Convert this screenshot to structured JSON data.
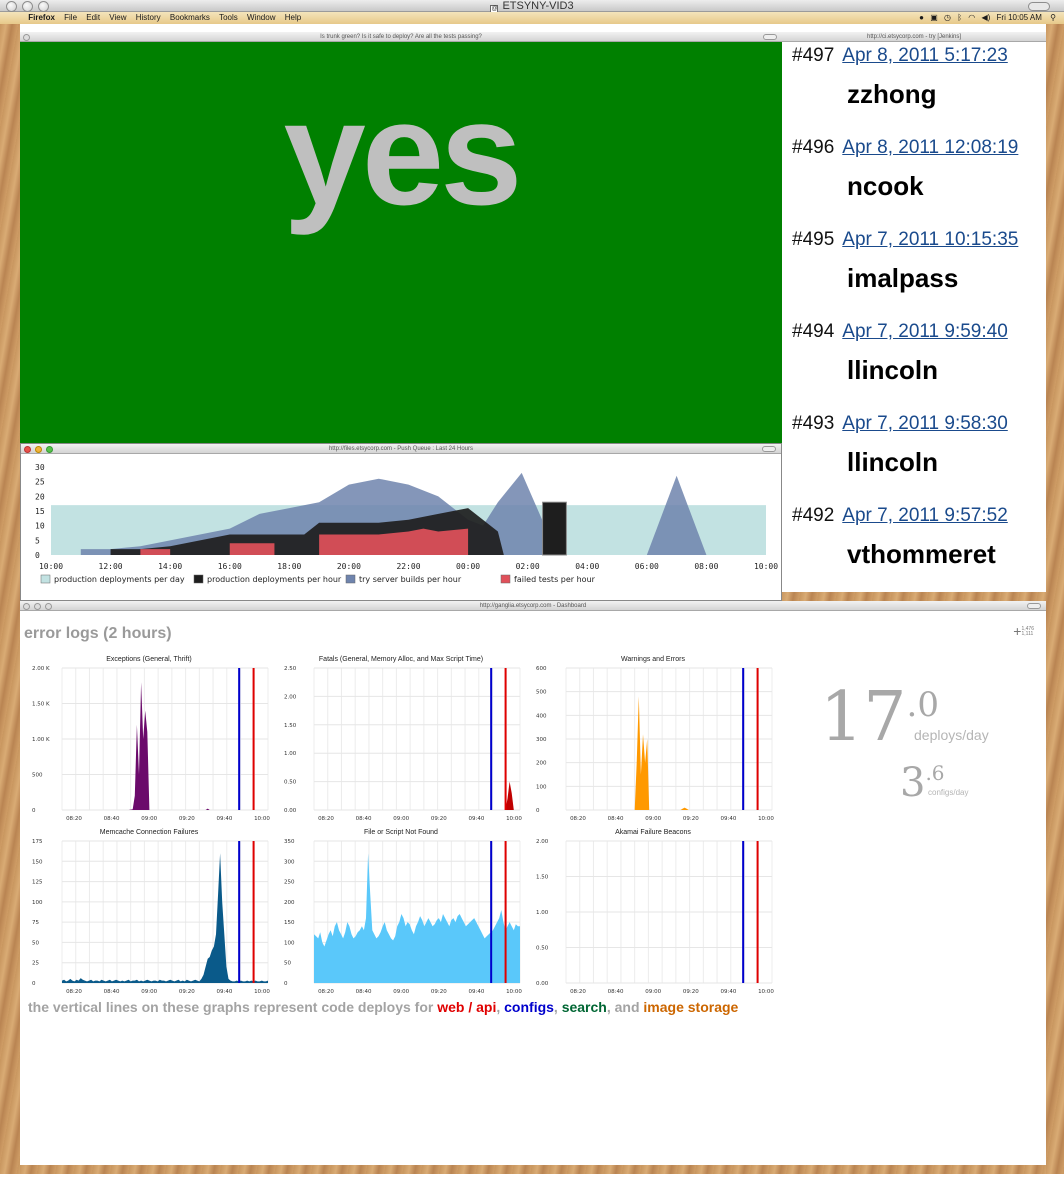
{
  "os": {
    "window_title": "ETSYNY-VID3",
    "menu": {
      "app": "Firefox",
      "items": [
        "File",
        "Edit",
        "View",
        "History",
        "Bookmarks",
        "Tools",
        "Window",
        "Help"
      ],
      "clock": "Fri 10:05 AM"
    }
  },
  "trunk": {
    "title": "Is trunk green? Is it safe to deploy? Are all the tests passing?",
    "answer": "yes",
    "bg_color": "#008000"
  },
  "jenkins": {
    "title": "http://ci.etsycorp.com - try [Jenkins]",
    "builds": [
      {
        "number": "#497",
        "date": "Apr 8, 2011 5:17:23",
        "user": "zzhong"
      },
      {
        "number": "#496",
        "date": "Apr 8, 2011 12:08:19",
        "user": "ncook"
      },
      {
        "number": "#495",
        "date": "Apr 7, 2011 10:15:35",
        "user": "imalpass"
      },
      {
        "number": "#494",
        "date": "Apr 7, 2011 9:59:40",
        "user": "llincoln"
      },
      {
        "number": "#493",
        "date": "Apr 7, 2011 9:58:30",
        "user": "llincoln"
      },
      {
        "number": "#492",
        "date": "Apr 7, 2011 9:57:52",
        "user": "vthommeret"
      }
    ]
  },
  "push_queue": {
    "title": "http://files.etsycorp.com - Push Queue : Last 24 Hours",
    "chart_data": {
      "type": "area",
      "x_ticks": [
        "10:00",
        "12:00",
        "14:00",
        "16:00",
        "18:00",
        "20:00",
        "22:00",
        "00:00",
        "02:00",
        "04:00",
        "06:00",
        "08:00",
        "10:00"
      ],
      "y_ticks": [
        0,
        5,
        10,
        15,
        20,
        25,
        30
      ],
      "ylim": [
        0,
        30
      ],
      "xlim": [
        0,
        24
      ],
      "series": [
        {
          "name": "production deployments per day",
          "color": "#c2e2e2",
          "kind": "band",
          "value": 17
        },
        {
          "name": "try server builds per hour",
          "color": "#6f84ad",
          "kind": "area",
          "points": [
            [
              1,
              0
            ],
            [
              1,
              2
            ],
            [
              2,
              2
            ],
            [
              3,
              3
            ],
            [
              4,
              5
            ],
            [
              5,
              7
            ],
            [
              6,
              9
            ],
            [
              7,
              14
            ],
            [
              8,
              16
            ],
            [
              9,
              18
            ],
            [
              10,
              24
            ],
            [
              11,
              26
            ],
            [
              12,
              24
            ],
            [
              13,
              20
            ],
            [
              14,
              12
            ],
            [
              14.5,
              10
            ],
            [
              15,
              18
            ],
            [
              15.8,
              28
            ],
            [
              17,
              0
            ]
          ]
        },
        {
          "name": "try server builds per hour peak",
          "color": "#6f84ad",
          "kind": "triangle",
          "points": [
            [
              20,
              0
            ],
            [
              21,
              27
            ],
            [
              22,
              0
            ]
          ]
        },
        {
          "name": "production deployments per hour",
          "color": "#1e1e1e",
          "kind": "area",
          "points": [
            [
              2,
              0
            ],
            [
              2,
              2
            ],
            [
              3,
              2
            ],
            [
              4,
              3
            ],
            [
              5,
              5
            ],
            [
              6,
              7
            ],
            [
              6.5,
              7
            ],
            [
              8.5,
              7
            ],
            [
              9,
              11
            ],
            [
              11,
              11
            ],
            [
              12,
              12
            ],
            [
              13,
              14
            ],
            [
              14,
              16
            ],
            [
              15,
              8
            ],
            [
              15.2,
              0
            ]
          ]
        },
        {
          "name": "production deployments per hour spike",
          "color": "#1e1e1e",
          "kind": "bar",
          "x0": 16.5,
          "x1": 17.3,
          "value": 18
        },
        {
          "name": "failed tests per hour",
          "color": "#e0505a",
          "kind": "area",
          "points": [
            [
              3,
              0
            ],
            [
              3,
              2
            ],
            [
              4,
              2
            ],
            [
              4,
              0
            ],
            [
              6,
              0
            ],
            [
              6,
              4
            ],
            [
              7,
              4
            ],
            [
              7.5,
              4
            ],
            [
              7.5,
              0
            ],
            [
              9,
              0
            ],
            [
              9,
              7
            ],
            [
              11,
              7
            ],
            [
              12,
              8
            ],
            [
              12.5,
              9
            ],
            [
              13,
              8
            ],
            [
              14,
              9
            ],
            [
              14,
              0
            ]
          ]
        }
      ],
      "legend": [
        {
          "label": "production deployments per day",
          "color": "#c2e2e2"
        },
        {
          "label": "production deployments per hour",
          "color": "#1e1e1e"
        },
        {
          "label": "try server builds per hour",
          "color": "#6f84ad"
        },
        {
          "label": "failed tests per hour",
          "color": "#e0505a"
        }
      ]
    }
  },
  "dashboard": {
    "title": "http://ganglia.etsycorp.com - Dashboard",
    "heading": "error logs (2 hours)",
    "cursor_readout": [
      "1,476",
      "1,111"
    ],
    "deploy_colors": {
      "web_api": "#e00000",
      "configs": "#0000cc"
    },
    "graphs_chart_data": [
      {
        "type": "area",
        "title": "Exceptions (General, Thrift)",
        "color": "#6b0a6b",
        "y_ticks": [
          "2.00 K",
          "1.50 K",
          "1.00 K",
          "500",
          "0"
        ],
        "ymax": 2000,
        "x_ticks": [
          "08:20",
          "08:40",
          "09:00",
          "09:20",
          "09:40",
          "10:00"
        ],
        "deploys": {
          "configs": 0.86,
          "web_api": 0.93
        },
        "values": [
          0,
          0,
          0,
          0,
          0,
          0,
          0,
          0,
          0,
          0,
          0,
          0,
          0,
          0,
          0,
          0,
          0,
          0,
          0,
          0,
          0,
          0,
          0,
          0,
          0,
          0,
          0,
          0,
          0,
          0,
          0,
          0,
          0,
          5,
          10,
          200,
          1200,
          500,
          1800,
          1000,
          1400,
          1100,
          0,
          0,
          0,
          0,
          0,
          0,
          0,
          0,
          0,
          0,
          0,
          0,
          0,
          0,
          0,
          0,
          0,
          0,
          0,
          0,
          0,
          0,
          0,
          0,
          0,
          0,
          0,
          0,
          20,
          0,
          0,
          0,
          0,
          0,
          0,
          0,
          0,
          0,
          0,
          0,
          0,
          0,
          0,
          0,
          0,
          0,
          0,
          0,
          0,
          0,
          0,
          0,
          0,
          0,
          0,
          0,
          0,
          0
        ]
      },
      {
        "type": "area",
        "title": "Fatals (General, Memory Alloc, and Max Script Time)",
        "color": "#c00000",
        "y_ticks": [
          "2.50",
          "2.00",
          "1.50",
          "1.00",
          "0.50",
          "0.00"
        ],
        "ymax": 2.5,
        "x_ticks": [
          "08:20",
          "08:40",
          "09:00",
          "09:20",
          "09:40",
          "10:00"
        ],
        "deploys": {
          "configs": 0.86,
          "web_api": 0.93
        },
        "values": [
          0,
          0,
          0,
          0,
          0,
          0,
          0,
          0,
          0,
          0,
          0,
          0,
          0,
          0,
          0,
          0,
          0,
          0,
          0,
          0,
          0,
          0,
          0,
          0,
          0,
          0,
          0,
          0,
          0,
          0,
          0,
          0,
          0,
          0,
          0,
          0,
          0,
          0,
          0,
          0,
          0,
          0,
          0,
          0,
          0,
          0,
          0,
          0,
          0,
          0,
          0,
          0,
          0,
          0,
          0,
          0,
          0,
          0,
          0,
          0,
          0,
          0,
          0,
          0,
          0,
          0,
          0,
          0,
          0,
          0,
          0,
          0,
          0,
          0,
          0,
          0,
          0,
          0,
          0,
          0,
          0,
          0,
          0,
          0,
          0,
          0,
          0,
          0,
          0,
          0,
          0,
          0,
          0,
          0.2,
          0.5,
          0.3,
          0,
          0,
          0,
          0
        ]
      },
      {
        "type": "area",
        "title": "Warnings and Errors",
        "color": "#ff9900",
        "y_ticks": [
          "600",
          "500",
          "400",
          "300",
          "200",
          "100",
          "0"
        ],
        "ymax": 600,
        "x_ticks": [
          "08:20",
          "08:40",
          "09:00",
          "09:20",
          "09:40",
          "10:00"
        ],
        "deploys": {
          "configs": 0.86,
          "web_api": 0.93
        },
        "values": [
          0,
          0,
          0,
          0,
          0,
          0,
          0,
          0,
          0,
          0,
          0,
          0,
          0,
          0,
          0,
          0,
          0,
          0,
          0,
          0,
          0,
          0,
          0,
          0,
          0,
          0,
          0,
          0,
          0,
          0,
          0,
          0,
          0,
          0,
          200,
          480,
          150,
          320,
          200,
          300,
          0,
          0,
          0,
          0,
          0,
          0,
          0,
          0,
          0,
          0,
          0,
          0,
          0,
          0,
          0,
          0,
          5,
          10,
          5,
          0,
          0,
          0,
          0,
          0,
          0,
          0,
          0,
          0,
          0,
          0,
          0,
          0,
          0,
          0,
          0,
          0,
          0,
          0,
          0,
          0,
          0,
          0,
          0,
          0,
          0,
          0,
          0,
          0,
          0,
          0,
          0,
          0,
          0,
          0,
          0,
          0,
          0,
          0,
          0,
          0
        ]
      },
      {
        "type": "area",
        "title": "Memcache Connection Failures",
        "color": "#0a5a8a",
        "y_ticks": [
          "175",
          "150",
          "125",
          "100",
          "75",
          "50",
          "25",
          "0"
        ],
        "ymax": 175,
        "x_ticks": [
          "08:20",
          "08:40",
          "09:00",
          "09:20",
          "09:40",
          "10:00"
        ],
        "deploys": {
          "configs": 0.86,
          "web_api": 0.93
        },
        "values": [
          3,
          4,
          2,
          3,
          5,
          3,
          2,
          4,
          3,
          6,
          4,
          3,
          2,
          3,
          4,
          2,
          3,
          3,
          2,
          4,
          3,
          2,
          3,
          4,
          2,
          3,
          4,
          3,
          2,
          3,
          2,
          3,
          4,
          2,
          3,
          3,
          4,
          2,
          3,
          2,
          3,
          4,
          3,
          2,
          3,
          3,
          2,
          4,
          3,
          3,
          2,
          3,
          4,
          3,
          2,
          3,
          4,
          2,
          3,
          2,
          4,
          3,
          2,
          3,
          4,
          3,
          2,
          5,
          10,
          20,
          30,
          32,
          40,
          45,
          60,
          110,
          160,
          100,
          60,
          20,
          5,
          3,
          2,
          2,
          3,
          2,
          3,
          2,
          2,
          3,
          2,
          3,
          2,
          3,
          2,
          2,
          3,
          2,
          2,
          3
        ]
      },
      {
        "type": "area",
        "title": "File or Script Not Found",
        "color": "#5ac8fa",
        "y_ticks": [
          "350",
          "300",
          "250",
          "200",
          "150",
          "100",
          "50",
          "0"
        ],
        "ymax": 350,
        "x_ticks": [
          "08:20",
          "08:40",
          "09:00",
          "09:20",
          "09:40",
          "10:00"
        ],
        "deploys": {
          "configs": 0.86,
          "web_api": 0.93
        },
        "values": [
          120,
          115,
          110,
          125,
          100,
          90,
          105,
          120,
          130,
          115,
          140,
          150,
          130,
          120,
          110,
          125,
          150,
          140,
          120,
          110,
          115,
          125,
          130,
          140,
          130,
          160,
          320,
          220,
          130,
          120,
          110,
          115,
          125,
          140,
          150,
          130,
          120,
          110,
          105,
          115,
          140,
          150,
          170,
          160,
          140,
          150,
          145,
          130,
          120,
          140,
          150,
          165,
          155,
          140,
          150,
          160,
          150,
          140,
          145,
          155,
          160,
          150,
          170,
          160,
          150,
          140,
          155,
          160,
          150,
          165,
          170,
          160,
          150,
          140,
          145,
          150,
          155,
          160,
          150,
          140,
          130,
          120,
          110,
          115,
          120,
          125,
          130,
          140,
          150,
          160,
          180,
          150,
          130,
          140,
          150,
          140,
          130,
          145,
          140,
          140
        ]
      },
      {
        "type": "area",
        "title": "Akamai Failure Beacons",
        "color": "#999999",
        "y_ticks": [
          "2.00",
          "1.50",
          "1.00",
          "0.50",
          "0.00"
        ],
        "ymax": 2,
        "x_ticks": [
          "08:20",
          "08:40",
          "09:00",
          "09:20",
          "09:40",
          "10:00"
        ],
        "deploys": {
          "configs": 0.86,
          "web_api": 0.93
        },
        "values": []
      }
    ],
    "deploys_per_day": {
      "whole": "17",
      "decimal": ".0",
      "unit": "deploys/day"
    },
    "configs_per_day": {
      "whole": "3",
      "decimal": ".6",
      "unit": "configs/day"
    },
    "legend": {
      "prefix": "the vertical lines on these graphs represent code deploys for ",
      "web_api": "web / api",
      "sep1": ", ",
      "configs": "configs",
      "sep2": ", ",
      "search": "search",
      "sep3": ", and ",
      "image_storage": "image storage",
      "colors": {
        "web_api": "#e00000",
        "configs": "#0000cc",
        "search": "#006633",
        "image_storage": "#cc6600"
      }
    }
  }
}
